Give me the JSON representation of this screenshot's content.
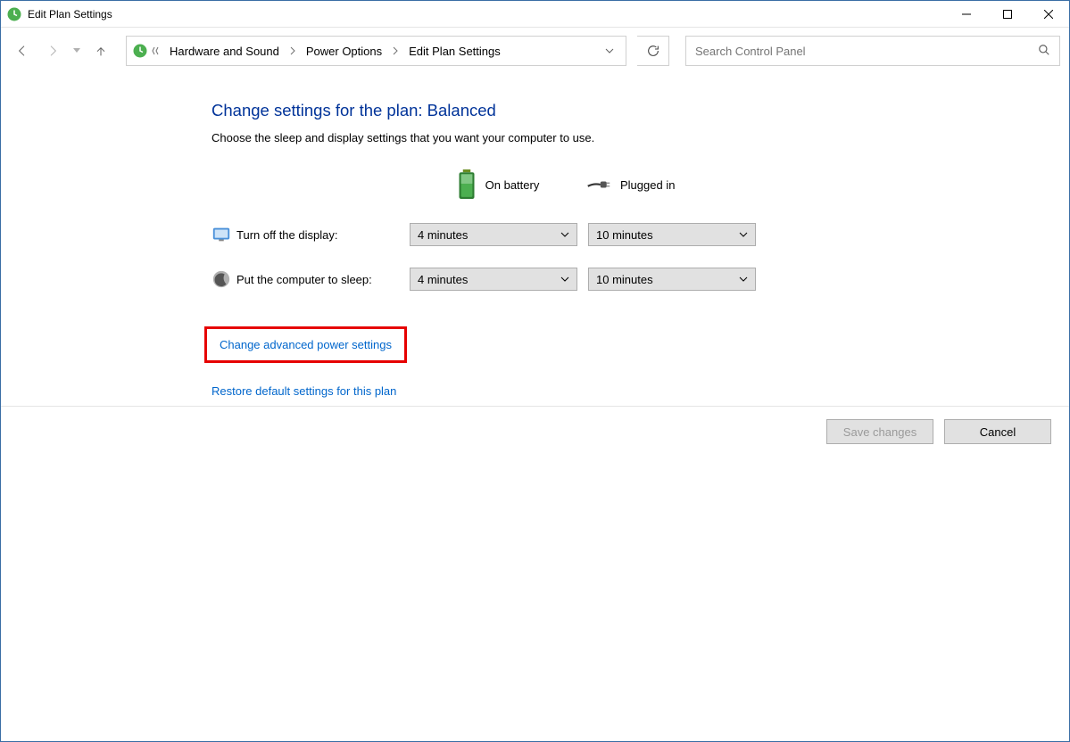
{
  "window": {
    "title": "Edit Plan Settings"
  },
  "breadcrumb": {
    "items": [
      "Hardware and Sound",
      "Power Options",
      "Edit Plan Settings"
    ]
  },
  "search": {
    "placeholder": "Search Control Panel"
  },
  "page": {
    "heading": "Change settings for the plan: Balanced",
    "subtext": "Choose the sleep and display settings that you want your computer to use."
  },
  "columns": {
    "battery": "On battery",
    "plugged": "Plugged in"
  },
  "settings": {
    "display": {
      "label": "Turn off the display:",
      "battery_value": "4 minutes",
      "plugged_value": "10 minutes"
    },
    "sleep": {
      "label": "Put the computer to sleep:",
      "battery_value": "4 minutes",
      "plugged_value": "10 minutes"
    }
  },
  "links": {
    "advanced": "Change advanced power settings",
    "restore": "Restore default settings for this plan"
  },
  "buttons": {
    "save": "Save changes",
    "cancel": "Cancel"
  }
}
